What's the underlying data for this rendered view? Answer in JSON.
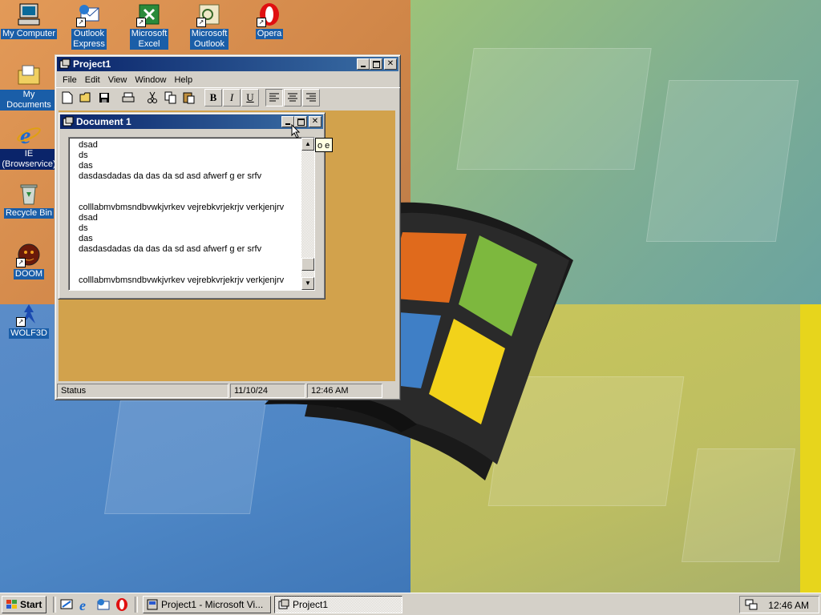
{
  "desktop": {
    "icons": [
      {
        "label": "My Computer",
        "icon": "computer-icon"
      },
      {
        "label": "Outlook\nExpress",
        "icon": "outlook-express-icon"
      },
      {
        "label": "Microsoft\nExcel",
        "icon": "excel-icon"
      },
      {
        "label": "Microsoft\nOutlook",
        "icon": "outlook-icon"
      },
      {
        "label": "Opera",
        "icon": "opera-icon"
      },
      {
        "label": "My Documents",
        "icon": "folder-icon"
      },
      {
        "label": "IE\n(Browservice)",
        "icon": "ie-icon"
      },
      {
        "label": "Recycle Bin",
        "icon": "recycle-bin-icon"
      },
      {
        "label": "DOOM",
        "icon": "doom-icon"
      },
      {
        "label": "WOLF3D",
        "icon": "wolf3d-icon"
      }
    ]
  },
  "project_window": {
    "title": "Project1",
    "menu": [
      "File",
      "Edit",
      "View",
      "Window",
      "Help"
    ],
    "toolbar": [
      "new-icon",
      "open-icon",
      "save-icon",
      "print-icon",
      "cut-icon",
      "copy-icon",
      "paste-icon",
      "bold-button",
      "italic-button",
      "underline-button",
      "align-left-button",
      "align-center-button",
      "align-right-button"
    ],
    "format_labels": {
      "bold": "B",
      "italic": "I",
      "underline": "U"
    },
    "status": {
      "text": "Status",
      "date": "11/10/24",
      "time": "12:46 AM"
    }
  },
  "document_window": {
    "title": "Document 1",
    "text": "dsad\nds\ndas\ndasdasdadas da das da sd asd afwerf g er srfv\n\n\ncolllabmvbmsndbvwkjvrkev vejrebkvrjekrjv verkjenjrv\ndsad\nds\ndas\ndasdasdadas da das da sd asd afwerf g er srfv\n\n\ncolllabmvbmsndbvwkjvrkev vejrebkvrjekrjv verkjenjrv"
  },
  "tooltip": {
    "text": "o e"
  },
  "taskbar": {
    "start_label": "Start",
    "quick_launch": [
      "show-desktop-icon",
      "ie-icon",
      "outlook-express-icon",
      "opera-icon"
    ],
    "tasks": [
      {
        "label": "Project1 - Microsoft Vi...",
        "pressed": false
      },
      {
        "label": "Project1",
        "pressed": true
      }
    ],
    "clock": "12:46 AM"
  },
  "colors": {
    "titlebar_active": "#0a246a",
    "mdi_background": "#d2a24c",
    "face": "#d4d0c8",
    "selection": "#0a246a"
  }
}
